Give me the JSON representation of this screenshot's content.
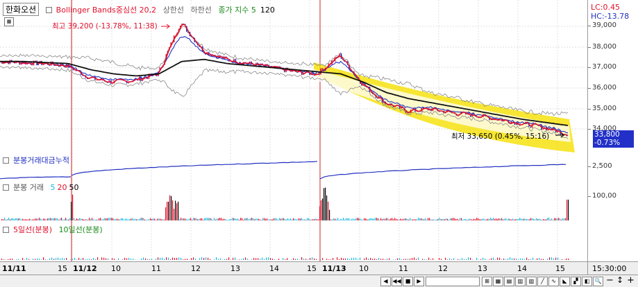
{
  "legend": {
    "title": "한화오션",
    "bb_name": "Bollinger Bands중심선 20,2",
    "upper": "상한선",
    "lower": "하한선",
    "close_index": "종가 지수 5",
    "close_index_val": "120"
  },
  "price_axis": {
    "lc": "LC:0.45",
    "hc": "HC:-13.78",
    "ticks": [
      "39,000",
      "38,000",
      "37,000",
      "36,000",
      "35,000",
      "34,000"
    ],
    "current_price": "33,800",
    "current_change": "-0.73%"
  },
  "annotations": {
    "high": "최고 39,200 (-13.78%, 11:38)",
    "low": "최저 33,650 (0.45%, 15:16)"
  },
  "cum_panel": {
    "title": "분봉거래대금누적",
    "tick": "2,500"
  },
  "vol_panel": {
    "title": "분봉 거래",
    "p1": "5",
    "p2": "20",
    "p3": "50",
    "tick": "100,00"
  },
  "ma_panel": {
    "ma5": "5일선(분봉)",
    "ma10": "10일선(분봉)"
  },
  "x_axis": {
    "labels": [
      "11/11",
      "15",
      "11/12",
      "10",
      "11",
      "12",
      "13",
      "14",
      "15",
      "11/13",
      "10",
      "11",
      "12",
      "13",
      "14",
      "15"
    ],
    "time": "15:30:00"
  },
  "colors": {
    "red": "#e0102a",
    "blue": "#2030c0",
    "green": "#1a8a1a",
    "yellow": "#f5e000",
    "cyan": "#18b8e0"
  },
  "chart_data": {
    "type": "line",
    "title": "한화오션",
    "ylim": [
      33500,
      39500
    ],
    "series": [
      {
        "name": "종가 지수 5",
        "values": [
          37300,
          37250,
          37200,
          37100,
          36500,
          36300,
          36400,
          36700,
          39200,
          37800,
          37400,
          37200,
          37000,
          36800,
          36700,
          37600,
          36200,
          35300,
          34900,
          35000,
          34800,
          34700,
          34500,
          34300,
          34100,
          33800
        ]
      },
      {
        "name": "Bollinger Bands중심선 20,2",
        "values": [
          37300,
          37300,
          37250,
          37200,
          36900,
          36700,
          36600,
          36700,
          37300,
          37400,
          37200,
          37100,
          37000,
          36900,
          36800,
          36700,
          36300,
          35800,
          35500,
          35300,
          35100,
          34900,
          34700,
          34500,
          34350,
          34200
        ]
      }
    ],
    "annotations": [
      "최고 39,200 (-13.78%, 11:38)",
      "최저 33,650 (0.45%, 15:16)"
    ]
  }
}
